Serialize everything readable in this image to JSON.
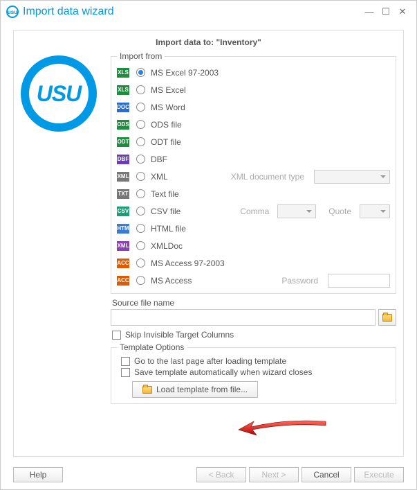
{
  "title": "Import data wizard",
  "header": "Import data to: \"Inventory\"",
  "logo_text": "USU",
  "import_from": {
    "legend": "Import from",
    "options": [
      {
        "id": "xls",
        "label": "MS Excel 97-2003",
        "badge": "XLS",
        "bg": "#1e8e3e",
        "checked": true
      },
      {
        "id": "xlsx",
        "label": "MS Excel",
        "badge": "XLSX",
        "bg": "#1e8e3e"
      },
      {
        "id": "docx",
        "label": "MS Word",
        "badge": "DOCX",
        "bg": "#2a6bd4"
      },
      {
        "id": "ods",
        "label": "ODS file",
        "badge": "ODS",
        "bg": "#1e8e3e"
      },
      {
        "id": "odt",
        "label": "ODT file",
        "badge": "ODT",
        "bg": "#1e8e3e"
      },
      {
        "id": "dbf",
        "label": "DBF",
        "badge": "DBF",
        "bg": "#6a3fb5"
      },
      {
        "id": "xml",
        "label": "XML",
        "badge": "XML",
        "bg": "#777"
      },
      {
        "id": "txt",
        "label": "Text file",
        "badge": "TXT",
        "bg": "#777"
      },
      {
        "id": "csv",
        "label": "CSV file",
        "badge": "CSV",
        "bg": "#1b9e77"
      },
      {
        "id": "html",
        "label": "HTML file",
        "badge": "HTML",
        "bg": "#3a7bd5"
      },
      {
        "id": "xmld",
        "label": "XMLDoc",
        "badge": "XMLD",
        "bg": "#8a3fb5"
      },
      {
        "id": "mdb",
        "label": "MS Access 97-2003",
        "badge": "ACC",
        "bg": "#e05a00"
      },
      {
        "id": "accd",
        "label": "MS Access",
        "badge": "ACC",
        "bg": "#e05a00"
      }
    ],
    "xml_type_label": "XML document type",
    "comma_label": "Comma",
    "quote_label": "Quote",
    "password_label": "Password"
  },
  "source": {
    "label": "Source file name",
    "value": ""
  },
  "skip_label": "Skip Invisible Target Columns",
  "template": {
    "legend": "Template Options",
    "last_page": "Go to the last page after loading template",
    "auto_save": "Save template automatically when wizard closes",
    "load_btn": "Load template from file..."
  },
  "footer": {
    "help": "Help",
    "back": "< Back",
    "next": "Next >",
    "cancel": "Cancel",
    "execute": "Execute"
  }
}
